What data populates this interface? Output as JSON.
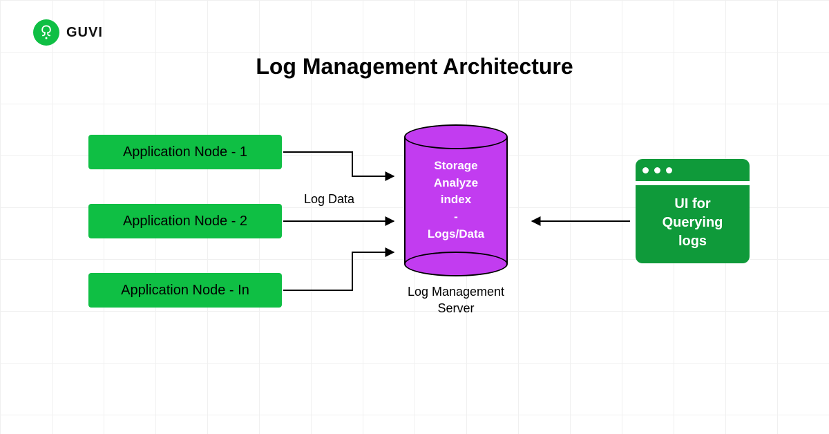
{
  "brand": {
    "name": "GUVI",
    "accent": "#0fbf44"
  },
  "title": "Log Management Architecture",
  "nodes": {
    "app1": "Application Node - 1",
    "app2": "Application Node - 2",
    "app3": "Application Node - In"
  },
  "edge_label": "Log Data",
  "database": {
    "text": "Storage\nAnalyze\nindex\n-\nLogs/Data",
    "label": "Log Management\nServer"
  },
  "ui_box": {
    "text": "UI for\nQuerying\nlogs"
  },
  "colors": {
    "green": "#0fbf44",
    "dark_green": "#0f9a3a",
    "purple": "#c23cf0",
    "black": "#000000"
  }
}
